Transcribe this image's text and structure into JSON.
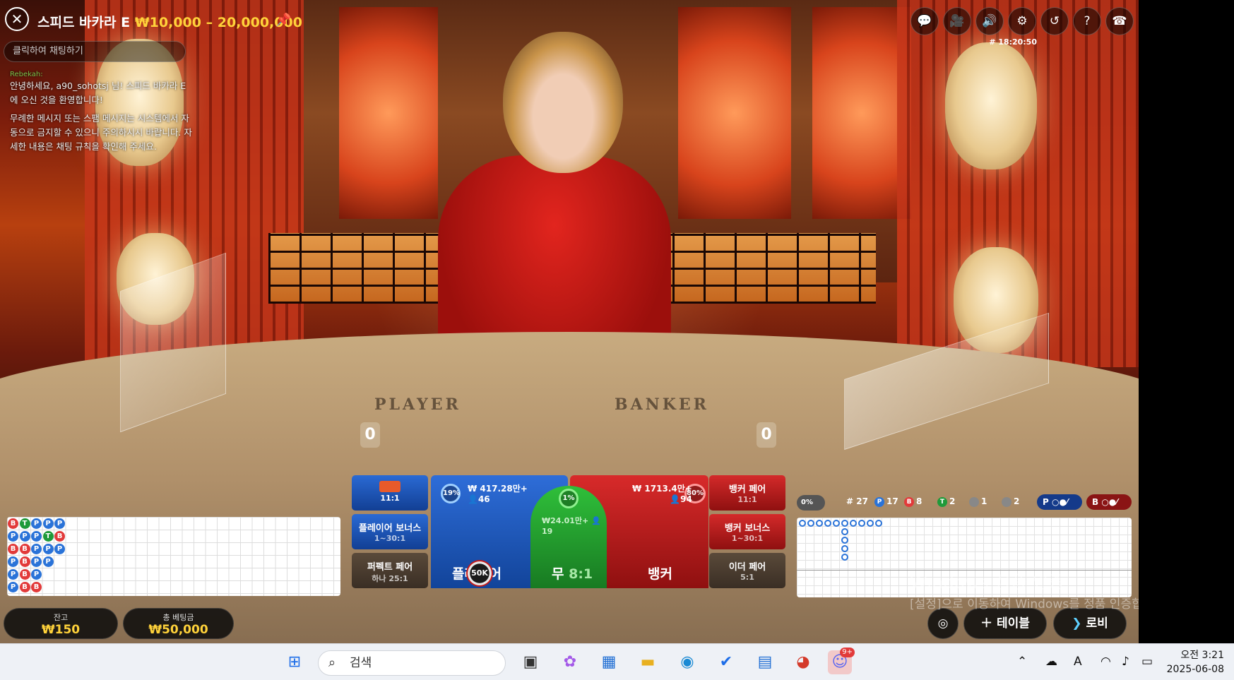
{
  "header": {
    "close_icon": "close-icon",
    "title": "스피드 바카라 E",
    "limits": "₩10,000 – 20,000,000",
    "pin_icon": "pin-icon",
    "round_id": "# 18:20:50"
  },
  "chat": {
    "placeholder": "클릭하여 채팅하기",
    "sender": "Rebekah:",
    "messages": [
      "안녕하세요, a90_sohotsj 님! 스피드 바카라 E에 오신 것을 환영합니다!",
      "무례한 메시지 또는 스팸 메시지는 시스템에서 자동으로 금지할 수 있으니 주의하시시 바랍니다. 자세한 내용은 채팅 규칙을 확인해 주세요."
    ]
  },
  "toolbar_icons": [
    "chat-icon",
    "video-icon",
    "sound-icon",
    "settings-icon",
    "history-icon",
    "help-icon",
    "lobby-support-icon"
  ],
  "table": {
    "player_label": "PLAYER",
    "banker_label": "BANKER",
    "player_score": "0",
    "banker_score": "0"
  },
  "bead_road": [
    [
      "B",
      "P",
      "B",
      "P",
      "P",
      "P"
    ],
    [
      "T",
      "P",
      "B",
      "B",
      "B",
      "B"
    ],
    [
      "P",
      "P",
      "P",
      "P",
      "P",
      "B"
    ],
    [
      "P",
      "T",
      "P",
      "P"
    ],
    [
      "P",
      "B",
      "P"
    ]
  ],
  "bets": {
    "side_left_top": {
      "label": "",
      "payout": "11:1"
    },
    "player_bonus": {
      "label": "플레이어 보너스",
      "payout": "1~30:1"
    },
    "perfect_pair": {
      "label": "퍼펙트 페어",
      "payout": "하나 25:1"
    },
    "player": {
      "label": "플레이어",
      "amount": "₩ 417.28만+",
      "players": "46",
      "percent": "19%"
    },
    "tie": {
      "label": "무",
      "payout": "8:1",
      "amount": "₩24.01만+",
      "players": "19",
      "percent": "1%"
    },
    "banker": {
      "label": "뱅커",
      "amount": "₩ 1713.4만+",
      "players": "94",
      "percent": "80%"
    },
    "banker_pair": {
      "label": "뱅커 페어",
      "payout": "11:1"
    },
    "banker_bonus": {
      "label": "뱅커 보너스",
      "payout": "1~30:1"
    },
    "either_pair": {
      "label": "이더 페어",
      "payout": "5:1"
    },
    "chip": "50K"
  },
  "wallet": {
    "balance_label": "잔고",
    "balance": "₩150",
    "total_bet_label": "총 베팅금",
    "total_bet": "₩50,000"
  },
  "stats": {
    "toggle": "0%",
    "rounds": "# 27",
    "player": "17",
    "banker": "8",
    "tie": "2",
    "player_pair": "1",
    "banker_pair": "2",
    "player_predict": "P",
    "banker_predict": "B"
  },
  "actions": {
    "table_label": "테이블",
    "lobby_label": "로비"
  },
  "watermark": {
    "title": "Windows 정품 인증",
    "subtitle": "[설정]으로 이동하여 Windows를 정품 인증합니다."
  },
  "taskbar": {
    "search_placeholder": "검색",
    "time": "오전 3:21",
    "date": "2025-06-08",
    "discord_badge": "9+"
  }
}
